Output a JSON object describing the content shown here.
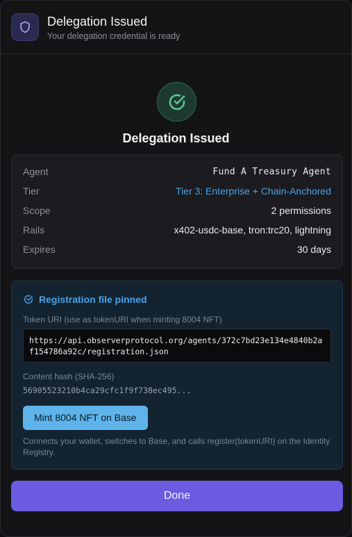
{
  "header": {
    "title": "Delegation Issued",
    "subtitle": "Your delegation credential is ready",
    "icon": "shield-icon"
  },
  "main": {
    "title": "Delegation Issued",
    "status_icon": "check-circle-icon",
    "accent_color": "#3fa37a"
  },
  "details": {
    "rows": [
      {
        "label": "Agent",
        "value": "Fund A Treasury Agent"
      },
      {
        "label": "Tier",
        "value": "Tier 3: Enterprise + Chain-Anchored"
      },
      {
        "label": "Scope",
        "value": "2 permissions"
      },
      {
        "label": "Rails",
        "value": "x402-usdc-base, tron:trc20, lightning"
      },
      {
        "label": "Expires",
        "value": "30 days"
      }
    ]
  },
  "registration": {
    "title": "Registration file pinned",
    "token_uri_label": "Token URI (use as tokenURI when minting 8004 NFT)",
    "token_uri": "https://api.observerprotocol.org/agents/372c7bd23e134e4840b2af154786a92c/registration.json",
    "hash_label": "Content hash (SHA-256)",
    "hash_value": "56905523210b4ca29cfc1f9f738ec495...",
    "mint_button": "Mint 8004 NFT on Base",
    "note": "Connects your wallet, switches to Base, and calls register(tokenURI) on the Identity Registry.",
    "accent_color": "#4aa3e6"
  },
  "footer": {
    "done_button": "Done",
    "button_color": "#6b5be0"
  }
}
